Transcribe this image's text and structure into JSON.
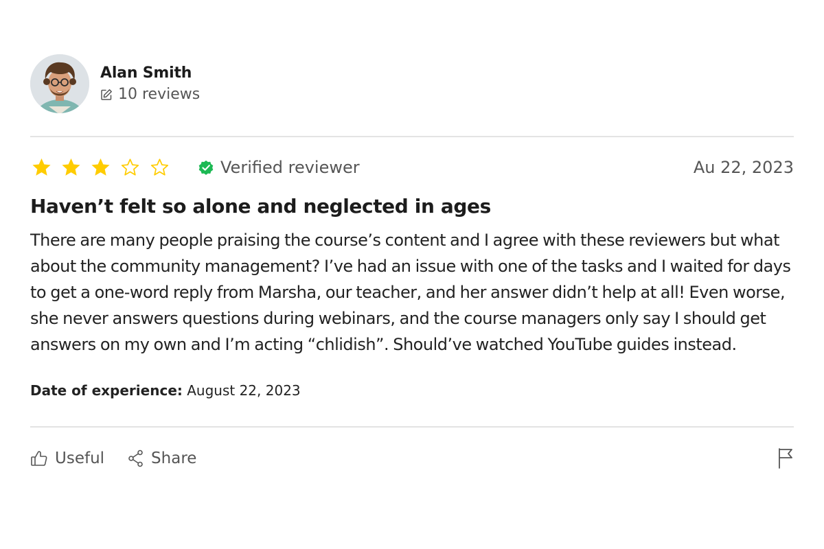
{
  "author": {
    "name": "Alan Smith",
    "reviews_count_label": "10 reviews",
    "avatar_icon": "avatar-photo"
  },
  "review": {
    "rating": 3,
    "max_rating": 5,
    "verified_label": "Verified reviewer",
    "date": "Au 22, 2023",
    "title": "Haven’t felt so alone and neglected in ages",
    "body": "There are many people praising the course’s content and I agree with these reviewers but what about the community management? I’ve had an issue with one of the tasks and I waited for days to get a one-word reply from Marsha, our teacher, and her answer didn’t help at all! Even worse, she never answers questions during webinars, and the course managers only say I should get answers on my own and I’m acting “chlidish”. Should’ve watched YouTube guides instead.",
    "experience_label": "Date of experience:",
    "experience_date": "August 22, 2023"
  },
  "actions": {
    "useful_label": "Useful",
    "share_label": "Share"
  },
  "colors": {
    "star": "#FFCC00",
    "verified": "#1DB954",
    "muted_text": "#555555",
    "divider": "#E3E3E3"
  }
}
